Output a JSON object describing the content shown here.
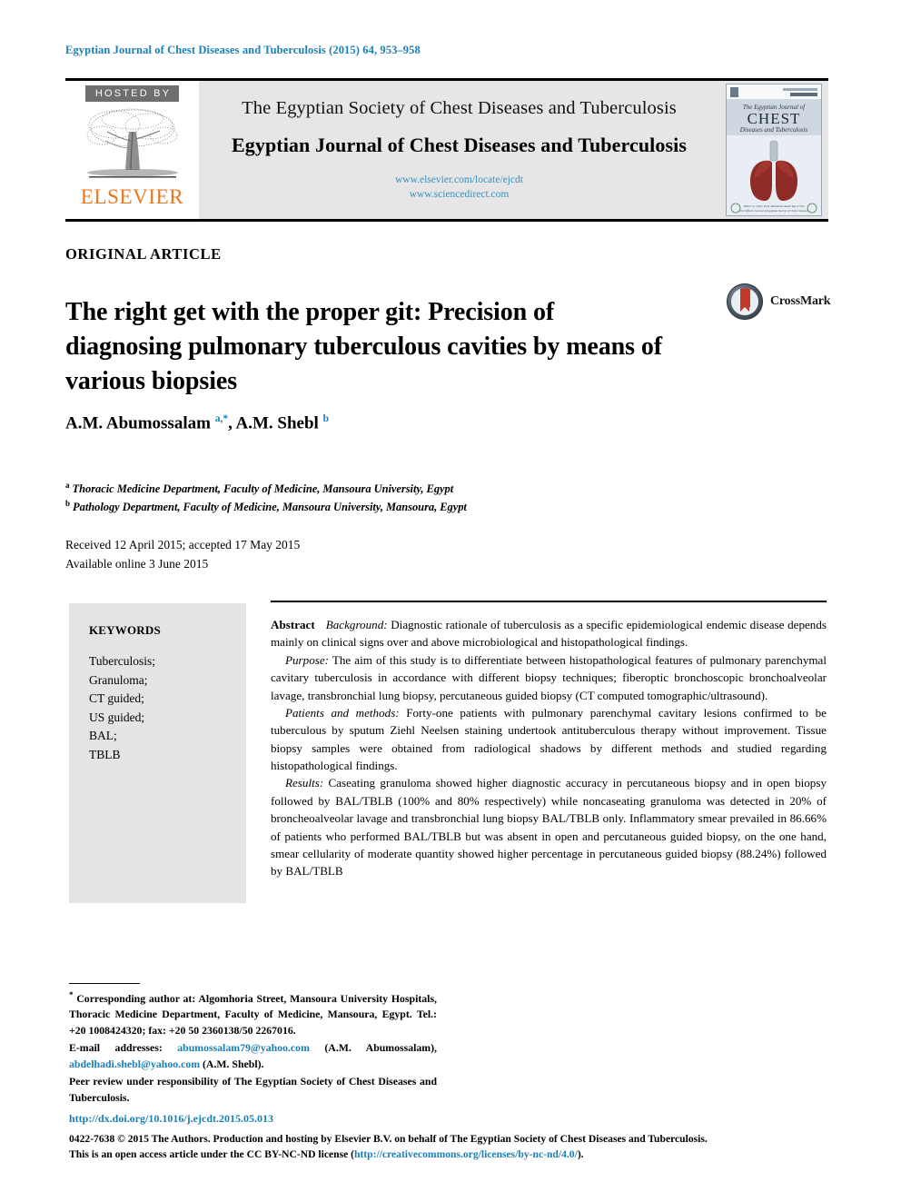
{
  "running_head": "Egyptian Journal of Chest Diseases and Tuberculosis (2015) 64, 953–958",
  "masthead": {
    "hosted_by": "HOSTED BY",
    "publisher": "ELSEVIER",
    "society_line": "The Egyptian Society of Chest Diseases and Tuberculosis",
    "journal_line": "Egyptian Journal of Chest Diseases and Tuberculosis",
    "url_1": "www.elsevier.com/locate/ejcdt",
    "url_2": "www.sciencedirect.com",
    "cover": {
      "kicker": "The Egyptian Journal of",
      "title": "CHEST",
      "subtitle": "Diseases and Tuberculosis"
    }
  },
  "article": {
    "type": "ORIGINAL ARTICLE",
    "title": "The right get with the proper git: Precision of diagnosing pulmonary tuberculous cavities by means of various biopsies",
    "crossmark_label": "CrossMark",
    "authors_html": "A.M. Abumossalam <sup>a,*</sup>, A.M. Shebl <sup>b</sup>",
    "affiliation_a": "Thoracic Medicine Department, Faculty of Medicine, Mansoura University, Egypt",
    "affiliation_b": "Pathology Department, Faculty of Medicine, Mansoura University, Mansoura, Egypt",
    "received_line": "Received 12 April 2015; accepted 17 May 2015",
    "available_line": "Available online 3 June 2015"
  },
  "keywords": {
    "heading": "KEYWORDS",
    "items": [
      "Tuberculosis;",
      "Granuloma;",
      "CT guided;",
      "US guided;",
      "BAL;",
      "TBLB"
    ]
  },
  "abstract": {
    "heading": "Abstract",
    "sections": [
      {
        "label": "Background:",
        "text": "Diagnostic rationale of tuberculosis as a specific epidemiological endemic disease depends mainly on clinical signs over and above microbiological and histopathological findings."
      },
      {
        "label": "Purpose:",
        "text": "The aim of this study is to differentiate between histopathological features of pulmonary parenchymal cavitary tuberculosis in accordance with different biopsy techniques; fiberoptic bronchoscopic bronchoalveolar lavage, transbronchial lung biopsy, percutaneous guided biopsy (CT computed tomographic/ultrasound)."
      },
      {
        "label": "Patients and methods:",
        "text": "Forty-one patients with pulmonary parenchymal cavitary lesions confirmed to be tuberculous by sputum Ziehl Neelsen staining undertook antituberculous therapy without improvement. Tissue biopsy samples were obtained from radiological shadows by different methods and studied regarding histopathological findings."
      },
      {
        "label": "Results:",
        "text": "Caseating granuloma showed higher diagnostic accuracy in percutaneous biopsy and in open biopsy followed by BAL/TBLB (100% and 80% respectively) while noncaseating granuloma was detected in 20% of broncheoalveolar lavage and transbronchial lung biopsy BAL/TBLB only. Inflammatory smear prevailed in 86.66% of patients who performed BAL/TBLB but was absent in open and percutaneous guided biopsy, on the one hand, smear cellularity of moderate quantity showed higher percentage in percutaneous guided biopsy (88.24%) followed by BAL/TBLB"
      }
    ]
  },
  "footnote": {
    "corresponding_marker": "*",
    "corresponding_text": "Corresponding author at: Algomhoria Street, Mansoura University Hospitals, Thoracic Medicine Department, Faculty of Medicine, Mansoura, Egypt. Tel.: +20 1008424320; fax: +20 50 2360138/50 2267016.",
    "email_label": "E-mail addresses:",
    "email_1": "abumossalam79@yahoo.com",
    "email_1_owner": "(A.M. Abumossalam),",
    "email_2": "abdelhadi.shebl@yahoo.com",
    "email_2_owner": "(A.M. Shebl).",
    "peer_review": "Peer review under responsibility of The Egyptian Society of Chest Diseases and Tuberculosis.",
    "doi": "http://dx.doi.org/10.1016/j.ejcdt.2015.05.013",
    "copyright_line_1": "0422-7638 © 2015 The Authors. Production and hosting by Elsevier B.V. on behalf of The Egyptian Society of Chest Diseases and Tuberculosis.",
    "copyright_line_2_pre": "This is an open access article under the CC BY-NC-ND license (",
    "copyright_license_url": "http://creativecommons.org/licenses/by-nc-nd/4.0/",
    "copyright_line_2_post": ")."
  },
  "colors": {
    "link": "#1a7fb5",
    "elsevier_orange": "#E87722",
    "panel_grey": "#e4e4e4",
    "masthead_grey": "#e6e6e6"
  }
}
